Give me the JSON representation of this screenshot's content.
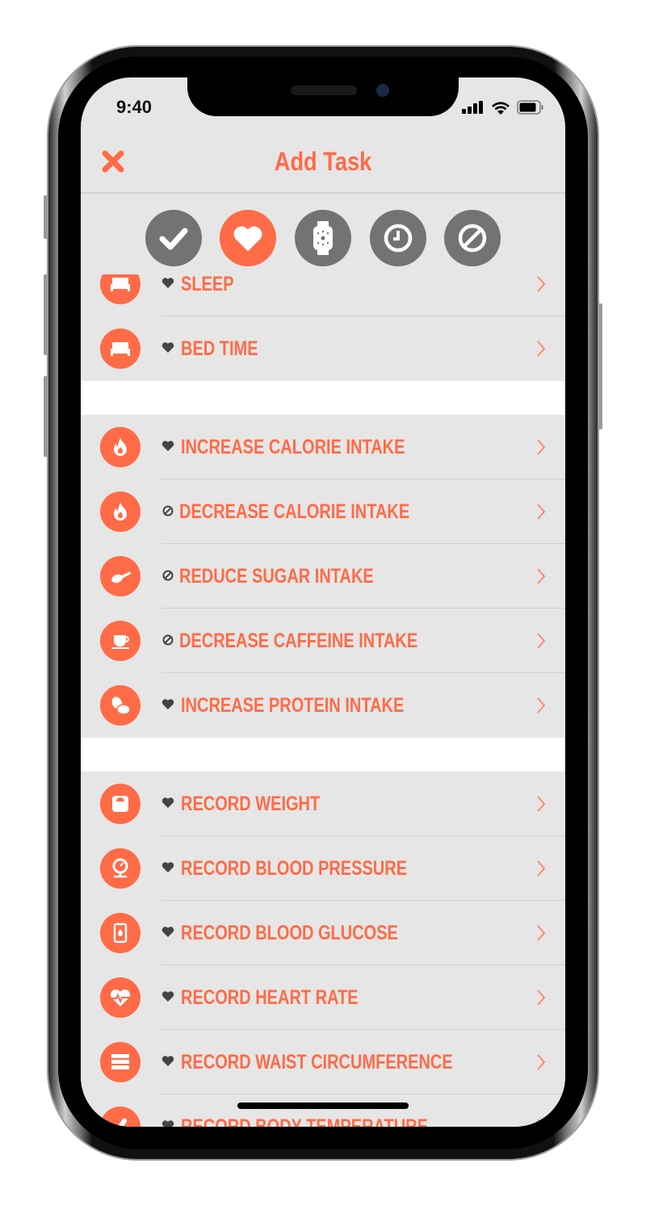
{
  "status_bar": {
    "time": "9:40"
  },
  "header": {
    "title": "Add Task",
    "close_icon": "close-icon"
  },
  "colors": {
    "accent": "#ff6b47",
    "filter_inactive": "#737373",
    "background": "#e6e6e6",
    "kind_icon": "#444444"
  },
  "filters": [
    {
      "icon": "checkmark-icon",
      "active": false
    },
    {
      "icon": "heart-icon",
      "active": true
    },
    {
      "icon": "watch-icon",
      "active": false
    },
    {
      "icon": "clock-icon",
      "active": false
    },
    {
      "icon": "ban-icon",
      "active": false
    }
  ],
  "sections": [
    {
      "rows": [
        {
          "label": "SLEEP",
          "kind": "heart",
          "icon": "bed-icon"
        },
        {
          "label": "BED TIME",
          "kind": "heart",
          "icon": "bed-icon"
        }
      ]
    },
    {
      "rows": [
        {
          "label": "INCREASE CALORIE INTAKE",
          "kind": "heart",
          "icon": "flame-icon"
        },
        {
          "label": "DECREASE CALORIE INTAKE",
          "kind": "ban",
          "icon": "flame-icon"
        },
        {
          "label": "REDUCE SUGAR INTAKE",
          "kind": "ban",
          "icon": "spoon-icon"
        },
        {
          "label": "DECREASE CAFFEINE INTAKE",
          "kind": "ban",
          "icon": "coffee-cup-icon"
        },
        {
          "label": "INCREASE PROTEIN INTAKE",
          "kind": "heart",
          "icon": "eggs-icon"
        }
      ]
    },
    {
      "rows": [
        {
          "label": "RECORD WEIGHT",
          "kind": "heart",
          "icon": "scale-icon"
        },
        {
          "label": "RECORD BLOOD PRESSURE",
          "kind": "heart",
          "icon": "blood-pressure-gauge-icon"
        },
        {
          "label": "RECORD BLOOD GLUCOSE",
          "kind": "heart",
          "icon": "glucose-meter-icon"
        },
        {
          "label": "RECORD HEART RATE",
          "kind": "heart",
          "icon": "heart-rate-icon"
        },
        {
          "label": "RECORD WAIST CIRCUMFERENCE",
          "kind": "heart",
          "icon": "tape-measure-icon"
        },
        {
          "label": "RECORD BODY TEMPERATURE",
          "kind": "heart",
          "icon": "thermometer-icon"
        }
      ]
    }
  ]
}
